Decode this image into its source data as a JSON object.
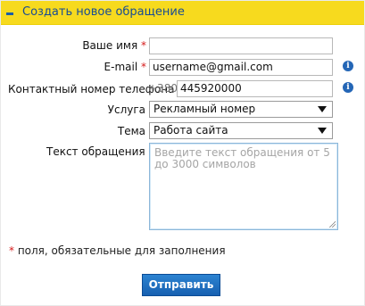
{
  "header": {
    "title": "Создать новое обращение",
    "collapse_icon": "minus-icon"
  },
  "form": {
    "name_label": "Ваше имя",
    "name_required": "*",
    "name_value": "",
    "email_label": "E-mail",
    "email_required": "*",
    "email_value": "username@gmail.com",
    "phone_label": "Контактный номер телефона",
    "phone_prefix": "+380",
    "phone_value": "445920000",
    "service_label": "Услуга",
    "service_value": "Рекламный номер",
    "topic_label": "Тема",
    "topic_value": "Работа сайта",
    "message_label": "Текст обращения",
    "message_required": "*",
    "message_placeholder": "Введите текст обращения от 5 до 3000 символов"
  },
  "note": {
    "star": "*",
    "text": "поля, обязательные для заполнения"
  },
  "button": {
    "submit": "Отправить"
  },
  "icons": {
    "email_info": "info-icon",
    "phone_info": "info-icon",
    "select_arrow": "chevron-down-icon"
  },
  "colors": {
    "header": "#f7da1e",
    "title": "#174b94",
    "required": "#d51a1a",
    "button": "#1760b1"
  }
}
